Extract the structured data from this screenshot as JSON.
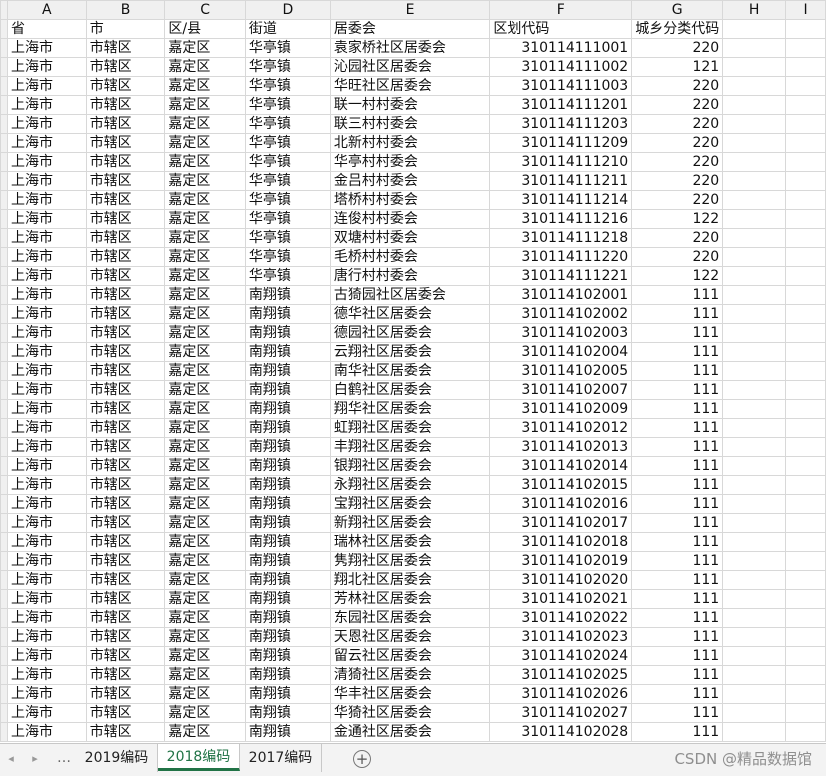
{
  "columns": [
    "A",
    "B",
    "C",
    "D",
    "E",
    "F",
    "G",
    "H",
    "I"
  ],
  "header_row": [
    "省",
    "市",
    "区/县",
    "街道",
    "居委会",
    "区划代码",
    "城乡分类代码",
    ""
  ],
  "rows": [
    [
      "上海市",
      "市辖区",
      "嘉定区",
      "华亭镇",
      "袁家桥社区居委会",
      "310114111001",
      "220"
    ],
    [
      "上海市",
      "市辖区",
      "嘉定区",
      "华亭镇",
      "沁园社区居委会",
      "310114111002",
      "121"
    ],
    [
      "上海市",
      "市辖区",
      "嘉定区",
      "华亭镇",
      "华旺社区居委会",
      "310114111003",
      "220"
    ],
    [
      "上海市",
      "市辖区",
      "嘉定区",
      "华亭镇",
      "联一村村委会",
      "310114111201",
      "220"
    ],
    [
      "上海市",
      "市辖区",
      "嘉定区",
      "华亭镇",
      "联三村村委会",
      "310114111203",
      "220"
    ],
    [
      "上海市",
      "市辖区",
      "嘉定区",
      "华亭镇",
      "北新村村委会",
      "310114111209",
      "220"
    ],
    [
      "上海市",
      "市辖区",
      "嘉定区",
      "华亭镇",
      "华亭村村委会",
      "310114111210",
      "220"
    ],
    [
      "上海市",
      "市辖区",
      "嘉定区",
      "华亭镇",
      "金吕村村委会",
      "310114111211",
      "220"
    ],
    [
      "上海市",
      "市辖区",
      "嘉定区",
      "华亭镇",
      "塔桥村村委会",
      "310114111214",
      "220"
    ],
    [
      "上海市",
      "市辖区",
      "嘉定区",
      "华亭镇",
      "连俊村村委会",
      "310114111216",
      "122"
    ],
    [
      "上海市",
      "市辖区",
      "嘉定区",
      "华亭镇",
      "双塘村村委会",
      "310114111218",
      "220"
    ],
    [
      "上海市",
      "市辖区",
      "嘉定区",
      "华亭镇",
      "毛桥村村委会",
      "310114111220",
      "220"
    ],
    [
      "上海市",
      "市辖区",
      "嘉定区",
      "华亭镇",
      "唐行村村委会",
      "310114111221",
      "122"
    ],
    [
      "上海市",
      "市辖区",
      "嘉定区",
      "南翔镇",
      "古猗园社区居委会",
      "310114102001",
      "111"
    ],
    [
      "上海市",
      "市辖区",
      "嘉定区",
      "南翔镇",
      "德华社区居委会",
      "310114102002",
      "111"
    ],
    [
      "上海市",
      "市辖区",
      "嘉定区",
      "南翔镇",
      "德园社区居委会",
      "310114102003",
      "111"
    ],
    [
      "上海市",
      "市辖区",
      "嘉定区",
      "南翔镇",
      "云翔社区居委会",
      "310114102004",
      "111"
    ],
    [
      "上海市",
      "市辖区",
      "嘉定区",
      "南翔镇",
      "南华社区居委会",
      "310114102005",
      "111"
    ],
    [
      "上海市",
      "市辖区",
      "嘉定区",
      "南翔镇",
      "白鹤社区居委会",
      "310114102007",
      "111"
    ],
    [
      "上海市",
      "市辖区",
      "嘉定区",
      "南翔镇",
      "翔华社区居委会",
      "310114102009",
      "111"
    ],
    [
      "上海市",
      "市辖区",
      "嘉定区",
      "南翔镇",
      "虹翔社区居委会",
      "310114102012",
      "111"
    ],
    [
      "上海市",
      "市辖区",
      "嘉定区",
      "南翔镇",
      "丰翔社区居委会",
      "310114102013",
      "111"
    ],
    [
      "上海市",
      "市辖区",
      "嘉定区",
      "南翔镇",
      "银翔社区居委会",
      "310114102014",
      "111"
    ],
    [
      "上海市",
      "市辖区",
      "嘉定区",
      "南翔镇",
      "永翔社区居委会",
      "310114102015",
      "111"
    ],
    [
      "上海市",
      "市辖区",
      "嘉定区",
      "南翔镇",
      "宝翔社区居委会",
      "310114102016",
      "111"
    ],
    [
      "上海市",
      "市辖区",
      "嘉定区",
      "南翔镇",
      "新翔社区居委会",
      "310114102017",
      "111"
    ],
    [
      "上海市",
      "市辖区",
      "嘉定区",
      "南翔镇",
      "瑞林社区居委会",
      "310114102018",
      "111"
    ],
    [
      "上海市",
      "市辖区",
      "嘉定区",
      "南翔镇",
      "隽翔社区居委会",
      "310114102019",
      "111"
    ],
    [
      "上海市",
      "市辖区",
      "嘉定区",
      "南翔镇",
      "翔北社区居委会",
      "310114102020",
      "111"
    ],
    [
      "上海市",
      "市辖区",
      "嘉定区",
      "南翔镇",
      "芳林社区居委会",
      "310114102021",
      "111"
    ],
    [
      "上海市",
      "市辖区",
      "嘉定区",
      "南翔镇",
      "东园社区居委会",
      "310114102022",
      "111"
    ],
    [
      "上海市",
      "市辖区",
      "嘉定区",
      "南翔镇",
      "天恩社区居委会",
      "310114102023",
      "111"
    ],
    [
      "上海市",
      "市辖区",
      "嘉定区",
      "南翔镇",
      "留云社区居委会",
      "310114102024",
      "111"
    ],
    [
      "上海市",
      "市辖区",
      "嘉定区",
      "南翔镇",
      "清猗社区居委会",
      "310114102025",
      "111"
    ],
    [
      "上海市",
      "市辖区",
      "嘉定区",
      "南翔镇",
      "华丰社区居委会",
      "310114102026",
      "111"
    ],
    [
      "上海市",
      "市辖区",
      "嘉定区",
      "南翔镇",
      "华猗社区居委会",
      "310114102027",
      "111"
    ],
    [
      "上海市",
      "市辖区",
      "嘉定区",
      "南翔镇",
      "金通社区居委会",
      "310114102028",
      "111"
    ]
  ],
  "sheet_tabs": {
    "prev_icon": "◂",
    "next_icon": "▸",
    "ellipsis": "…",
    "tabs": [
      "2019编码",
      "2018编码",
      "2017编码"
    ],
    "active_index": 1,
    "add_icon": "+"
  },
  "watermark": "CSDN @精品数据馆",
  "colors": {
    "active_tab": "#217346",
    "header_bg": "#f0f0f0",
    "gridline": "#d8d8d8"
  }
}
